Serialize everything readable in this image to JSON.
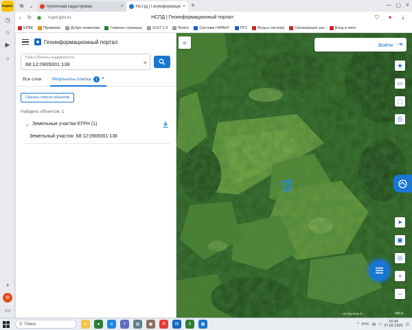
{
  "browser": {
    "sidepanel_logo": "ЯНДЕКС",
    "tabs": [
      {
        "label": "публичная кадастровая",
        "active": false
      },
      {
        "label": "НСПД | Геоинформацио",
        "active": true
      }
    ],
    "url": "nspd.gov.ru",
    "page_title": "НСПД | Геоинформационный портал",
    "bookmarks": [
      {
        "label": "ЕРВК",
        "color": "#c62828"
      },
      {
        "label": "Проверки",
        "color": "#c9a000"
      },
      {
        "label": "Добро пожалова",
        "color": "#9aa0a6"
      },
      {
        "label": "Главная страница",
        "color": "#2e7d32"
      },
      {
        "label": "10.67.1.3",
        "color": "#9aa0a6"
      },
      {
        "label": "Redoc",
        "color": "#9aa0a6"
      },
      {
        "label": "Система ГАРАНТ",
        "color": "#1565c0"
      },
      {
        "label": "ПГС",
        "color": "#1565c0"
      },
      {
        "label": "Вход в систему",
        "color": "#c62828"
      },
      {
        "label": "Организация зан",
        "color": "#c62828"
      },
      {
        "label": "Вход в личн",
        "color": "#c62828"
      }
    ]
  },
  "app": {
    "title": "Геоинформационный портал",
    "search": {
      "placeholder": "Поиск Объекты недвижимости",
      "value": "68:12:0905001:138"
    },
    "tabs": {
      "all_layers": "Все слои",
      "results": "Результаты поиска",
      "results_count": "1"
    },
    "download_button": "Скачать список объектов",
    "found_count": "Найдено объектов: 1",
    "group_label": "Земельные участки ЕГРН (1)",
    "result_item": "Земельный участок: 68:12:0905001:138"
  },
  "map": {
    "login_label": "Войти",
    "attribution": "НСПД 2020 ©",
    "scale": "200 m",
    "accent_color": "#1976d2"
  },
  "taskbar": {
    "search_placeholder": "Поиск",
    "keyboard_lang": "РУС",
    "time": "16:34",
    "date": "27.02.2026"
  }
}
